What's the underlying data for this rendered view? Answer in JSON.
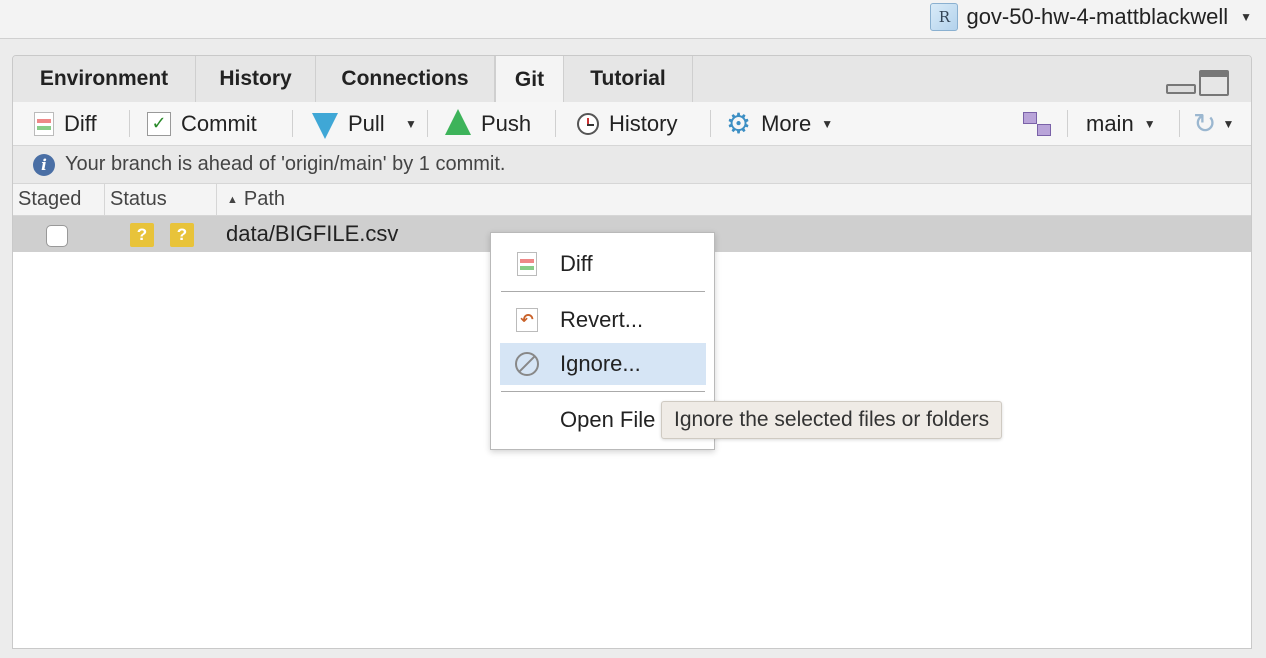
{
  "project": {
    "name": "gov-50-hw-4-mattblackwell",
    "icon": "r-project-icon"
  },
  "tabs": [
    {
      "label": "Environment"
    },
    {
      "label": "History"
    },
    {
      "label": "Connections"
    },
    {
      "label": "Git",
      "active": true
    },
    {
      "label": "Tutorial"
    }
  ],
  "toolbar": {
    "diff": "Diff",
    "commit": "Commit",
    "pull": "Pull",
    "push": "Push",
    "history": "History",
    "more": "More",
    "branch": "main"
  },
  "info": {
    "message": "Your branch is ahead of 'origin/main' by 1 commit."
  },
  "table": {
    "columns": [
      "Staged",
      "Status",
      "Path"
    ],
    "rows": [
      {
        "staged": false,
        "status": [
          "?",
          "?"
        ],
        "path": "data/BIGFILE.csv"
      }
    ]
  },
  "context_menu": {
    "items": [
      "Diff",
      "Revert...",
      "Ignore...",
      "Open File"
    ],
    "highlighted": "Ignore..."
  },
  "tooltip": {
    "text": "Ignore the selected files or folders"
  },
  "colors": {
    "status_untracked": "#e8c33a",
    "menu_highlight": "#d6e5f5",
    "selected_row": "#cfcfcf"
  }
}
